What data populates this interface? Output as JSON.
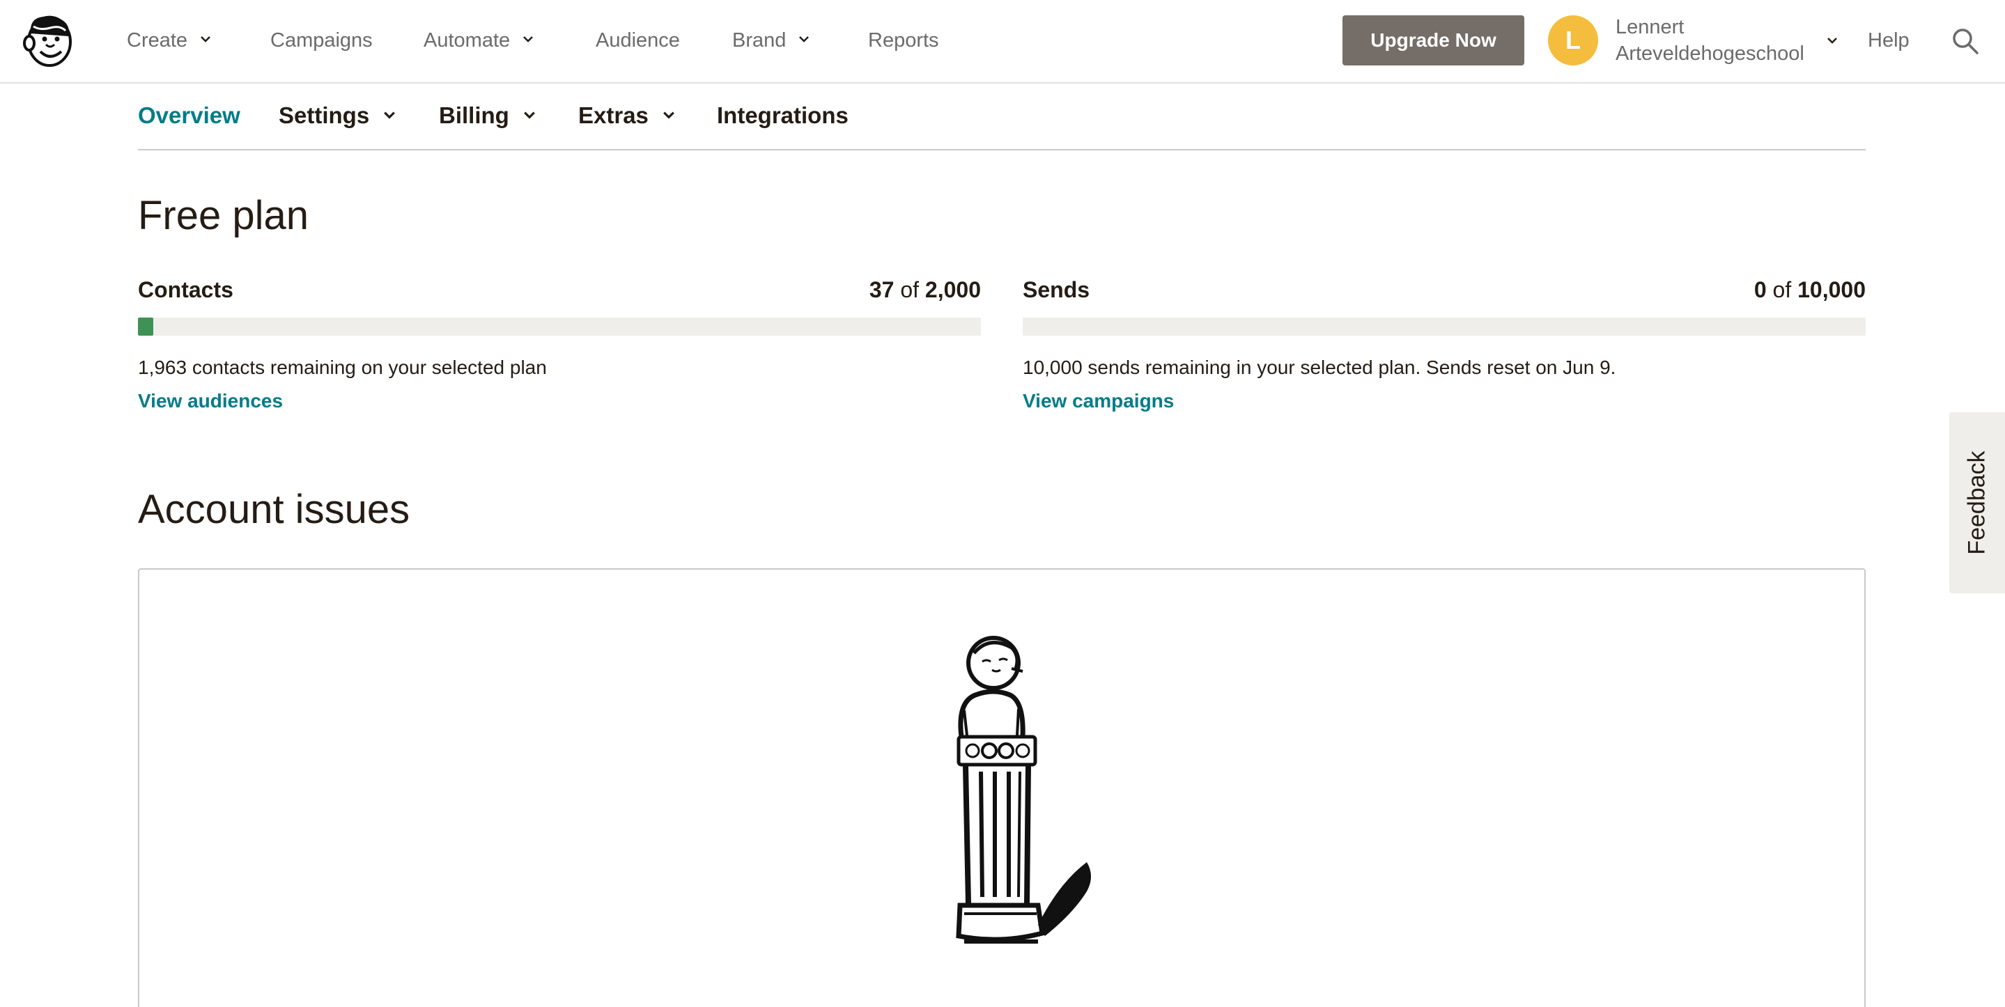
{
  "topnav": {
    "items": [
      {
        "label": "Create",
        "has_dropdown": true
      },
      {
        "label": "Campaigns",
        "has_dropdown": false
      },
      {
        "label": "Automate",
        "has_dropdown": true
      },
      {
        "label": "Audience",
        "has_dropdown": false
      },
      {
        "label": "Brand",
        "has_dropdown": true
      },
      {
        "label": "Reports",
        "has_dropdown": false
      }
    ],
    "upgrade_label": "Upgrade Now",
    "avatar_initial": "L",
    "user_first": "Lennert",
    "user_last": "Arteveldehogeschool",
    "help_label": "Help"
  },
  "subnav": {
    "items": [
      {
        "label": "Overview",
        "active": true,
        "has_dropdown": false
      },
      {
        "label": "Settings",
        "active": false,
        "has_dropdown": true
      },
      {
        "label": "Billing",
        "active": false,
        "has_dropdown": true
      },
      {
        "label": "Extras",
        "active": false,
        "has_dropdown": true
      },
      {
        "label": "Integrations",
        "active": false,
        "has_dropdown": false
      }
    ]
  },
  "plan": {
    "title": "Free plan",
    "contacts": {
      "label": "Contacts",
      "used": "37",
      "of": "of",
      "total": "2,000",
      "progress_fraction": 0.0185,
      "description": "1,963 contacts remaining on your selected plan",
      "link": "View audiences"
    },
    "sends": {
      "label": "Sends",
      "used": "0",
      "of": "of",
      "total": "10,000",
      "progress_fraction": 0,
      "description": "10,000 sends remaining in your selected plan. Sends reset on Jun 9.",
      "link": "View campaigns"
    }
  },
  "issues": {
    "title": "Account issues"
  },
  "feedback": {
    "label": "Feedback"
  },
  "colors": {
    "accent_link": "#007c89",
    "progress_fill": "#3e9255",
    "progress_track": "#efeeea",
    "upgrade_button": "#746d68",
    "avatar": "#f5bd3d"
  },
  "icons": {
    "logo": "mailchimp-freddie-logo",
    "search": "search-icon",
    "dropdown": "chevron-down-icon",
    "illustration": "column-statue-illustration"
  }
}
